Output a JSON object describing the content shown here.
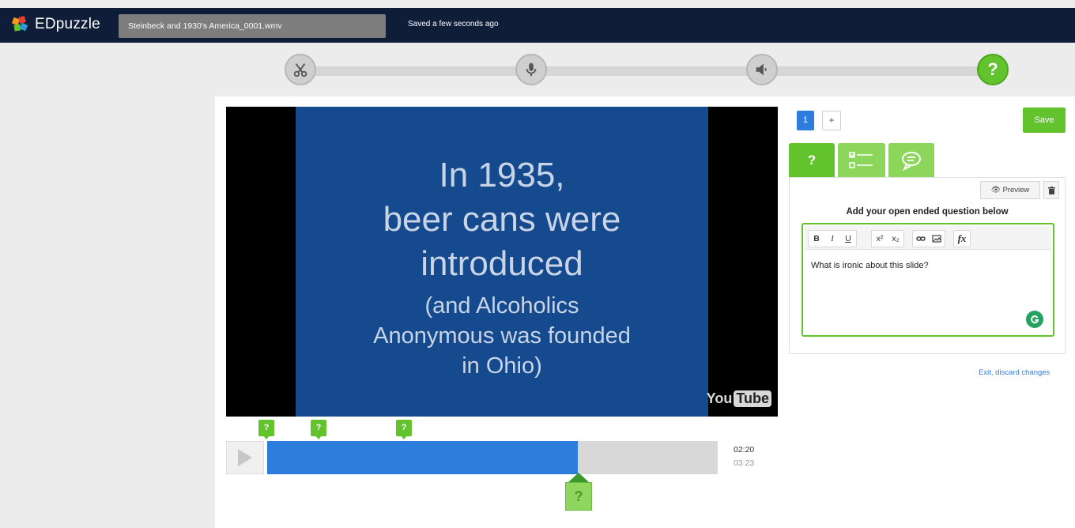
{
  "app": {
    "brand": "EDpuzzle",
    "filename": "Steinbeck and 1930's America_0001.wmv",
    "save_status": "Saved a few seconds ago"
  },
  "steps": [
    {
      "name": "cut",
      "icon": "scissors-icon",
      "active": false
    },
    {
      "name": "voiceover",
      "icon": "microphone-icon",
      "active": false
    },
    {
      "name": "audio-notes",
      "icon": "speaker-icon",
      "active": false
    },
    {
      "name": "quiz",
      "icon": "question-icon",
      "label": "?",
      "active": true
    }
  ],
  "video": {
    "slide_lines_large": [
      "In 1935,",
      "beer cans were",
      "introduced"
    ],
    "slide_lines_small": [
      "(and Alcoholics",
      "Anonymous was founded",
      "in Ohio)"
    ],
    "watermark_you": "You",
    "watermark_tube": "Tube"
  },
  "timeline": {
    "markers": [
      "?",
      "?",
      "?"
    ],
    "progress_fraction": 0.69,
    "current_time": "02:20",
    "total_time": "03:23",
    "handle_label": "?"
  },
  "editor": {
    "question_number": "1",
    "add_label": "+",
    "save_label": "Save",
    "tabs": [
      {
        "name": "open-ended",
        "label": "?",
        "active": true
      },
      {
        "name": "multiple-choice",
        "icon": "checklist-icon",
        "active": false
      },
      {
        "name": "comment",
        "icon": "speech-bubble-icon",
        "active": false
      }
    ],
    "preview_label": "Preview",
    "heading": "Add your open ended question below",
    "toolbar": [
      "B",
      "I",
      "U",
      "x²",
      "x₂",
      "link",
      "image",
      "fx"
    ],
    "content": "What is ironic about this slide?",
    "exit_label": "Exit, discard changes"
  },
  "colors": {
    "topbar": "#0f1d38",
    "accent_green": "#62c32d",
    "accent_blue": "#2d7ddd",
    "slide_bg": "#154a8e"
  }
}
